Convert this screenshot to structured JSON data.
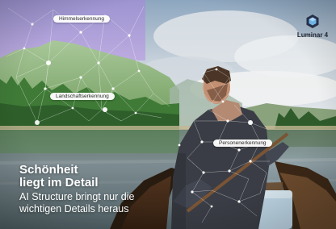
{
  "brand": {
    "logo_icon": "luminar-hexagon-icon",
    "name": "Luminar 4"
  },
  "labels": {
    "sky": "Himmelserkennung",
    "landscape": "Landschaftserkennung",
    "person": "Personenerkennung"
  },
  "headline": {
    "line1": "Schönheit",
    "line2": "liegt im Detail"
  },
  "subline": {
    "line1": "AI Structure bringt nur die",
    "line2": "wichtigen Details heraus"
  },
  "colors": {
    "brand_text": "#1f2430",
    "logo": "#253047",
    "label_background": "#ffffff",
    "headline_text": "#ffffff"
  }
}
